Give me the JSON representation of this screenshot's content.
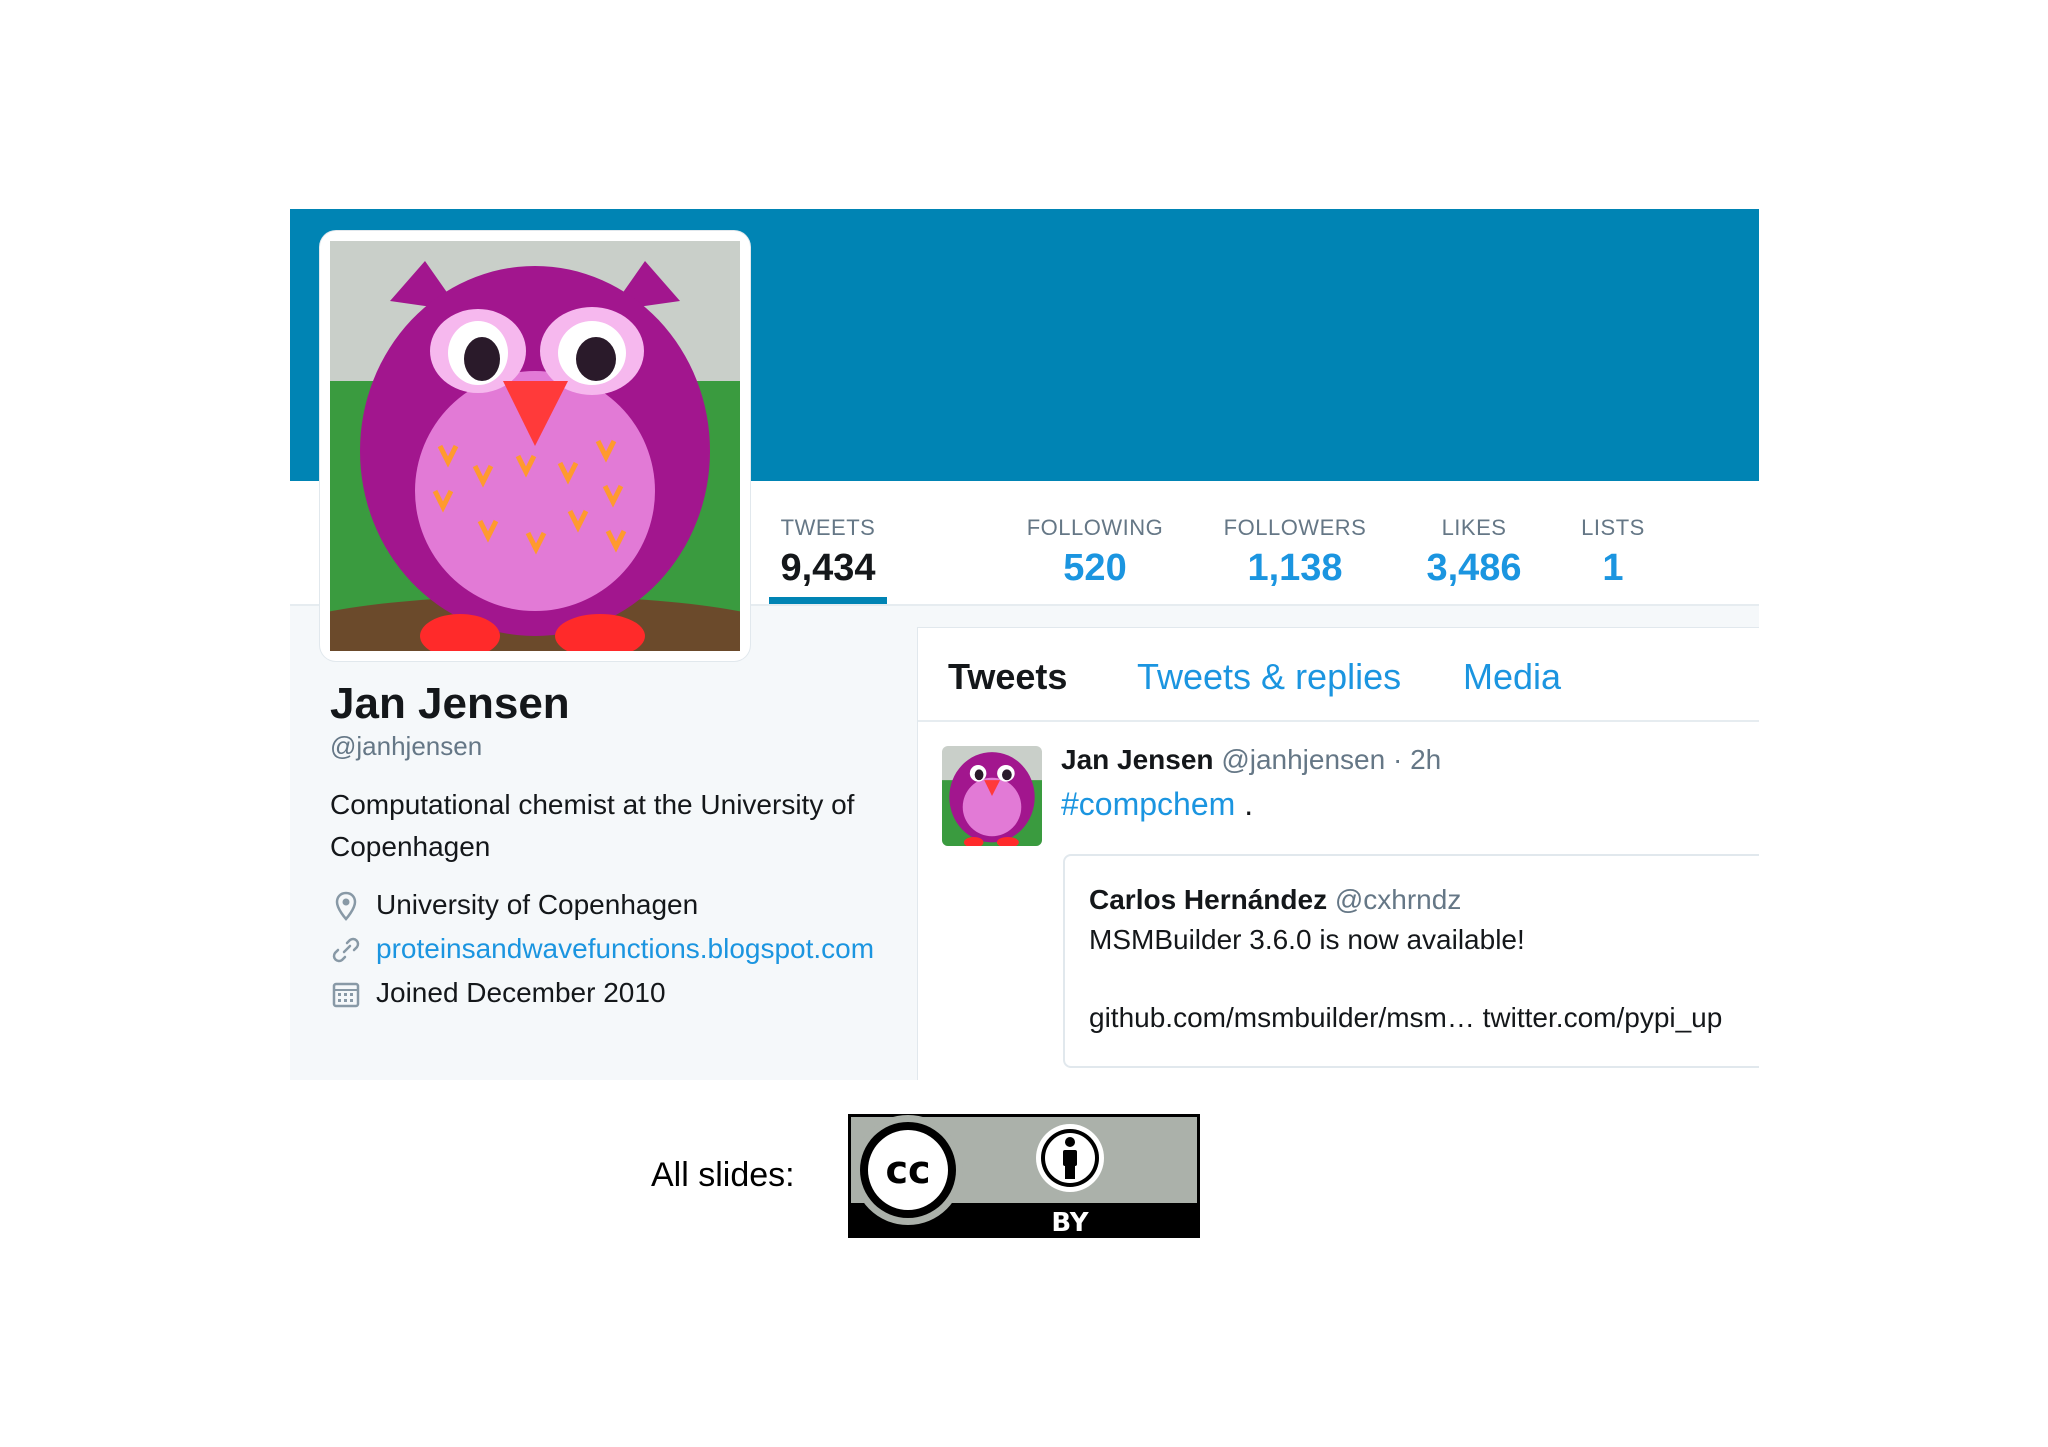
{
  "profile": {
    "name": "Jan Jensen",
    "handle": "@janhjensen",
    "bio": "Computational chemist at the University of Copenhagen",
    "location": "University of Copenhagen",
    "website": "proteinsandwavefunctions.blogspot.com",
    "joined": "Joined December 2010",
    "avatar_icon": "owl-avatar"
  },
  "stats": [
    {
      "label": "TWEETS",
      "value": "9,434",
      "active": true
    },
    {
      "label": "FOLLOWING",
      "value": "520"
    },
    {
      "label": "FOLLOWERS",
      "value": "1,138"
    },
    {
      "label": "LIKES",
      "value": "3,486"
    },
    {
      "label": "LISTS",
      "value": "1"
    }
  ],
  "tabs": [
    {
      "label": "Tweets",
      "active": true
    },
    {
      "label": "Tweets & replies"
    },
    {
      "label": "Media"
    }
  ],
  "tweet": {
    "author": "Jan Jensen",
    "handle": "@janhjensen",
    "time": "· 2h",
    "hashtag": "#compchem",
    "trailing": ".",
    "quote": {
      "author": "Carlos Hernández",
      "handle": "@cxhrndz",
      "text": "MSMBuilder 3.6.0 is now available!",
      "links": "github.com/msmbuilder/msm… twitter.com/pypi_up"
    }
  },
  "footer": {
    "caption": "All slides:",
    "license_cc": "cc",
    "license_by": "BY"
  },
  "colors": {
    "banner": "#0084b4",
    "link": "#1b95e0",
    "text": "#14171a",
    "muted": "#657786"
  }
}
